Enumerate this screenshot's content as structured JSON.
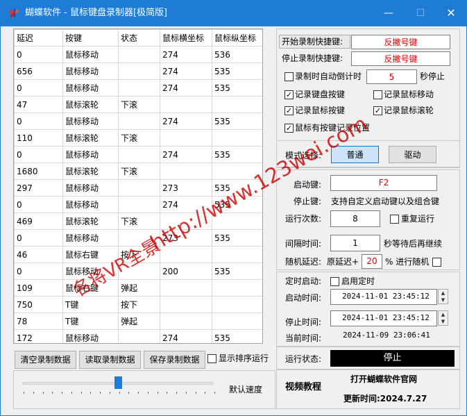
{
  "window": {
    "title": "蝴蝶软件 - 鼠标键盘录制器[极简版]",
    "minimize": "—",
    "maximize": "☐",
    "close": "✕"
  },
  "table": {
    "headers": [
      "延迟",
      "按键",
      "状态",
      "鼠标横坐标",
      "鼠标纵坐标"
    ],
    "rows": [
      [
        "0",
        "鼠标移动",
        "",
        "274",
        "536"
      ],
      [
        "656",
        "鼠标移动",
        "",
        "274",
        "535"
      ],
      [
        "0",
        "鼠标移动",
        "",
        "274",
        "535"
      ],
      [
        "47",
        "鼠标滚轮",
        "下滚",
        "",
        ""
      ],
      [
        "0",
        "鼠标移动",
        "",
        "274",
        "535"
      ],
      [
        "110",
        "鼠标滚轮",
        "下滚",
        "",
        ""
      ],
      [
        "0",
        "鼠标移动",
        "",
        "274",
        "535"
      ],
      [
        "1680",
        "鼠标滚轮",
        "下滚",
        "",
        ""
      ],
      [
        "297",
        "鼠标移动",
        "",
        "273",
        "535"
      ],
      [
        "0",
        "鼠标移动",
        "",
        "274",
        "535"
      ],
      [
        "469",
        "鼠标滚轮",
        "下滚",
        "",
        ""
      ],
      [
        "0",
        "鼠标移动",
        "",
        "273",
        "535"
      ],
      [
        "46",
        "鼠标右键",
        "按下",
        "",
        ""
      ],
      [
        "0",
        "鼠标移动",
        "",
        "200",
        "535"
      ],
      [
        "109",
        "鼠标右键",
        "弹起",
        "",
        ""
      ],
      [
        "750",
        "T键",
        "按下",
        "",
        ""
      ],
      [
        "78",
        "T键",
        "弹起",
        "",
        ""
      ],
      [
        "172",
        "鼠标移动",
        "",
        "274",
        "535"
      ]
    ]
  },
  "buttons": {
    "clear": "清空录制数据",
    "read": "读取录制数据",
    "save": "保存录制数据",
    "show_sort": "显示排序运行"
  },
  "speed": {
    "label": "默认速度",
    "level": 0.5
  },
  "hotkeys": {
    "start_label": "开始录制快捷键:",
    "start_value": "反撇号键",
    "stop_label": "停止录制快捷键:",
    "stop_value": "反撇号键"
  },
  "record_options": {
    "countdown_label": "录制时自动倒计时",
    "countdown_value": "5",
    "countdown_unit": "秒停止",
    "keyboard": "记录键盘按键",
    "mouse_move": "记录鼠标移动",
    "mouse_keys": "记录鼠标按键",
    "mouse_wheel": "记录鼠标滚轮",
    "record_position": "鼠标有按键记录位置"
  },
  "mode": {
    "label": "模式选择:",
    "normal": "普通",
    "driver": "驱动"
  },
  "run": {
    "start_key_label": "启动键:",
    "start_key_value": "F2",
    "stop_key_label": "停止键:",
    "stop_key_desc": "支持自定义启动键以及组合键",
    "count_label": "运行次数:",
    "count_value": "8",
    "repeat_label": "重复运行",
    "interval_label": "间隔时间:",
    "interval_value": "1",
    "interval_desc": "秒等待后再继续",
    "random_label": "随机延迟:",
    "random_prefix": "原延迟+",
    "random_value": "20",
    "random_suffix": "% 进行随机"
  },
  "timer": {
    "label": "定时启动:",
    "enable": "启用定时",
    "start_label": "启动时间:",
    "start_value": "2024-11-01  23:45:12",
    "stop_label": "停止时间:",
    "stop_value": "2024-11-01  23:45:12",
    "current_label": "当前时间:",
    "current_value": "2024-11-09  23:06:41"
  },
  "status": {
    "label": "运行状态:",
    "value": "停止"
  },
  "footer": {
    "video": "视频教程",
    "website": "打开蝴蝶软件官网",
    "update": "更新时间:2024.7.27"
  },
  "watermark": {
    "url": "http://www.123wei.com",
    "text": "名将VR全景"
  },
  "colors": {
    "titlebar": "#1e7cd6",
    "accent_red": "#e00000",
    "mode_selected": "#cce4f7"
  }
}
